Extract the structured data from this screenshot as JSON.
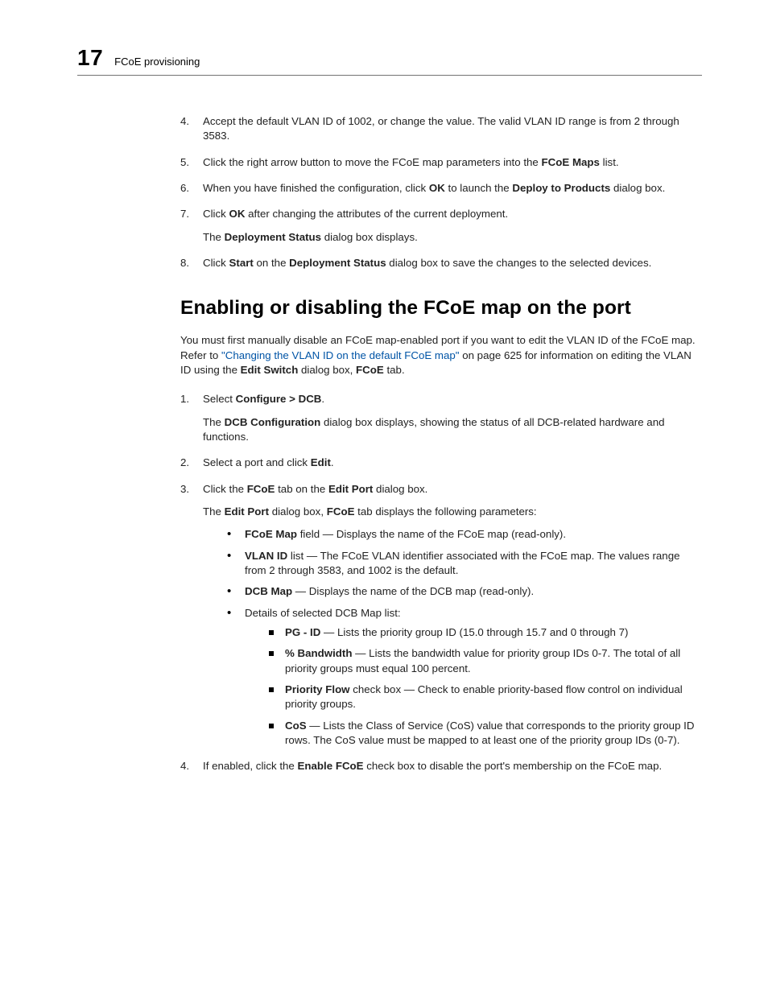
{
  "header": {
    "chapter_number": "17",
    "running_title": "FCoE provisioning"
  },
  "top_steps": [
    {
      "num": "4.",
      "paras": [
        [
          {
            "t": "Accept the default VLAN ID of 1002, or change the value. The valid VLAN ID range is from 2 through 3583."
          }
        ]
      ]
    },
    {
      "num": "5.",
      "paras": [
        [
          {
            "t": "Click the right arrow button to move the FCoE map parameters into the "
          },
          {
            "t": "FCoE Maps",
            "b": true
          },
          {
            "t": " list."
          }
        ]
      ]
    },
    {
      "num": "6.",
      "paras": [
        [
          {
            "t": "When you have finished the configuration, click "
          },
          {
            "t": "OK",
            "b": true
          },
          {
            "t": " to launch the "
          },
          {
            "t": "Deploy to Products",
            "b": true
          },
          {
            "t": " dialog box."
          }
        ]
      ]
    },
    {
      "num": "7.",
      "paras": [
        [
          {
            "t": "Click "
          },
          {
            "t": "OK",
            "b": true
          },
          {
            "t": " after changing the attributes of the current deployment."
          }
        ],
        [
          {
            "t": "The "
          },
          {
            "t": "Deployment Status",
            "b": true
          },
          {
            "t": " dialog box displays."
          }
        ]
      ]
    },
    {
      "num": "8.",
      "paras": [
        [
          {
            "t": "Click "
          },
          {
            "t": "Start",
            "b": true
          },
          {
            "t": " on the "
          },
          {
            "t": "Deployment Status",
            "b": true
          },
          {
            "t": " dialog box to save the changes to the selected devices."
          }
        ]
      ]
    }
  ],
  "section_title": "Enabling or disabling the FCoE map on the port",
  "intro_runs": [
    {
      "t": "You must first manually disable an FCoE map-enabled port if you want to edit the VLAN ID of the FCoE map. Refer to "
    },
    {
      "t": "\"Changing the VLAN ID on the default FCoE map\"",
      "link": true
    },
    {
      "t": " on page 625 for information on editing the VLAN ID using the "
    },
    {
      "t": "Edit Switch",
      "b": true
    },
    {
      "t": " dialog box, "
    },
    {
      "t": "FCoE",
      "b": true
    },
    {
      "t": " tab."
    }
  ],
  "main_steps": [
    {
      "num": "1.",
      "paras": [
        [
          {
            "t": "Select "
          },
          {
            "t": "Configure > DCB",
            "b": true
          },
          {
            "t": "."
          }
        ],
        [
          {
            "t": "The "
          },
          {
            "t": "DCB Configuration",
            "b": true
          },
          {
            "t": " dialog box displays, showing the status of all DCB-related hardware and functions."
          }
        ]
      ]
    },
    {
      "num": "2.",
      "paras": [
        [
          {
            "t": "Select a port and click "
          },
          {
            "t": "Edit",
            "b": true
          },
          {
            "t": "."
          }
        ]
      ]
    },
    {
      "num": "3.",
      "paras": [
        [
          {
            "t": "Click the "
          },
          {
            "t": "FCoE",
            "b": true
          },
          {
            "t": " tab on the "
          },
          {
            "t": "Edit Port",
            "b": true
          },
          {
            "t": " dialog box."
          }
        ],
        [
          {
            "t": "The "
          },
          {
            "t": "Edit Port",
            "b": true
          },
          {
            "t": " dialog box, "
          },
          {
            "t": "FCoE",
            "b": true
          },
          {
            "t": " tab displays the following parameters:"
          }
        ]
      ],
      "bullets": [
        {
          "runs": [
            {
              "t": "FCoE Map",
              "b": true
            },
            {
              "t": " field — Displays the name of the FCoE map (read-only)."
            }
          ]
        },
        {
          "runs": [
            {
              "t": "VLAN ID",
              "b": true
            },
            {
              "t": " list — The FCoE VLAN identifier associated with the FCoE map. The values range from 2 through 3583, and 1002 is the default."
            }
          ]
        },
        {
          "runs": [
            {
              "t": "DCB Map",
              "b": true
            },
            {
              "t": " — Displays the name of the DCB map (read-only)."
            }
          ]
        },
        {
          "runs": [
            {
              "t": "Details of selected DCB Map list:"
            }
          ],
          "squares": [
            {
              "runs": [
                {
                  "t": "PG - ID",
                  "b": true
                },
                {
                  "t": " — Lists the priority group ID (15.0 through 15.7 and 0 through 7)"
                }
              ]
            },
            {
              "runs": [
                {
                  "t": "% Bandwidth",
                  "b": true
                },
                {
                  "t": " — Lists the bandwidth value for priority group IDs 0-7. The total of all priority groups must equal 100 percent."
                }
              ]
            },
            {
              "runs": [
                {
                  "t": "Priority Flow",
                  "b": true
                },
                {
                  "t": " check box — Check to enable priority-based flow control on individual priority groups."
                }
              ]
            },
            {
              "runs": [
                {
                  "t": "CoS",
                  "b": true
                },
                {
                  "t": " — Lists the Class of Service (CoS) value that corresponds to the priority group ID rows. The CoS value must be mapped to at least one of the priority group IDs (0-7)."
                }
              ]
            }
          ]
        }
      ]
    },
    {
      "num": "4.",
      "paras": [
        [
          {
            "t": "If enabled, click the "
          },
          {
            "t": "Enable FCoE",
            "b": true
          },
          {
            "t": " check box to disable the port's membership on the FCoE map."
          }
        ]
      ]
    }
  ]
}
